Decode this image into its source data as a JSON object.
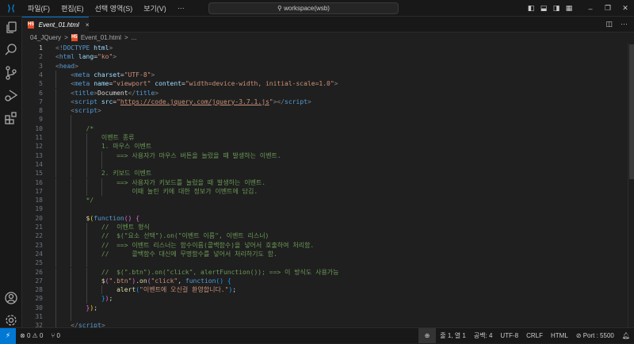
{
  "titlebar": {
    "menus": [
      "파일(F)",
      "편집(E)",
      "선택 영역(S)",
      "보기(V)",
      "···"
    ],
    "search": "workspace(wsb)",
    "back": "←",
    "forward": "→",
    "minimize": "–",
    "restore": "❐",
    "close": "✕"
  },
  "tab": {
    "label": "Event_01.html",
    "icon": "H5",
    "close": "×",
    "more": "···"
  },
  "breadcrumb": {
    "folder": "04_JQuery",
    "sep": ">",
    "file": "Event_01.html",
    "more": "..."
  },
  "editor": {
    "current_line": 1,
    "lines": [
      {
        "i": 0,
        "t": [
          [
            "<!",
            "t"
          ],
          [
            "DOCTYPE ",
            "n"
          ],
          [
            "html",
            "a"
          ],
          [
            ">",
            "t"
          ]
        ]
      },
      {
        "i": 0,
        "t": [
          [
            "<",
            "t"
          ],
          [
            "html ",
            "n"
          ],
          [
            "lang",
            "a"
          ],
          [
            "=",
            "x"
          ],
          [
            "\"ko\"",
            "s"
          ],
          [
            ">",
            "t"
          ]
        ]
      },
      {
        "i": 0,
        "t": [
          [
            "<",
            "t"
          ],
          [
            "head",
            "n"
          ],
          [
            ">",
            "t"
          ]
        ]
      },
      {
        "i": 1,
        "t": [
          [
            "<",
            "t"
          ],
          [
            "meta ",
            "n"
          ],
          [
            "charset",
            "a"
          ],
          [
            "=",
            "x"
          ],
          [
            "\"UTF-8\"",
            "s"
          ],
          [
            ">",
            "t"
          ]
        ]
      },
      {
        "i": 1,
        "t": [
          [
            "<",
            "t"
          ],
          [
            "meta ",
            "n"
          ],
          [
            "name",
            "a"
          ],
          [
            "=",
            "x"
          ],
          [
            "\"viewport\" ",
            "s"
          ],
          [
            "content",
            "a"
          ],
          [
            "=",
            "x"
          ],
          [
            "\"width=device-width, initial-scale=1.0\"",
            "s"
          ],
          [
            ">",
            "t"
          ]
        ]
      },
      {
        "i": 1,
        "t": [
          [
            "<",
            "t"
          ],
          [
            "title",
            "n"
          ],
          [
            ">",
            "t"
          ],
          [
            "Document",
            "x"
          ],
          [
            "</",
            "t"
          ],
          [
            "title",
            "n"
          ],
          [
            ">",
            "t"
          ]
        ]
      },
      {
        "i": 1,
        "t": [
          [
            "<",
            "t"
          ],
          [
            "script ",
            "n"
          ],
          [
            "src",
            "a"
          ],
          [
            "=",
            "x"
          ],
          [
            "\"",
            "s"
          ],
          [
            "https://code.jquery.com/jquery-3.7.1.js",
            "s u"
          ],
          [
            "\"",
            "s"
          ],
          [
            "></",
            "t"
          ],
          [
            "script",
            "n"
          ],
          [
            ">",
            "t"
          ]
        ]
      },
      {
        "i": 1,
        "t": [
          [
            "<",
            "t"
          ],
          [
            "script",
            "n"
          ],
          [
            ">",
            "t"
          ]
        ]
      },
      {
        "i": 2,
        "t": []
      },
      {
        "i": 2,
        "t": [
          [
            "/*",
            "c"
          ]
        ]
      },
      {
        "i": 3,
        "t": [
          [
            "이벤트 종류",
            "c"
          ]
        ]
      },
      {
        "i": 3,
        "t": [
          [
            "1. 마우스 이벤트",
            "c"
          ]
        ]
      },
      {
        "i": 4,
        "t": [
          [
            "==> 사용자가 마우스 버튼을 눌렀을 때 발생하는 이벤트.",
            "c"
          ]
        ]
      },
      {
        "i": 4,
        "t": []
      },
      {
        "i": 3,
        "t": [
          [
            "2. 키보드 이벤트",
            "c"
          ]
        ]
      },
      {
        "i": 4,
        "t": [
          [
            "==> 사용자가 키보드를 눌렀을 때 발생하는 이벤트.",
            "c"
          ]
        ]
      },
      {
        "i": 4,
        "t": [
          [
            "    이때 눌린 키에 대한 정보가 이벤트에 담김.",
            "c"
          ]
        ]
      },
      {
        "i": 2,
        "t": [
          [
            "*/",
            "c"
          ]
        ]
      },
      {
        "i": 2,
        "t": []
      },
      {
        "i": 2,
        "t": [
          [
            "$",
            "f"
          ],
          [
            "(",
            "y"
          ],
          [
            "function",
            "k"
          ],
          [
            "() ",
            "p"
          ],
          [
            "{",
            "p"
          ]
        ]
      },
      {
        "i": 3,
        "t": [
          [
            "//  이벤트 형식",
            "c"
          ]
        ]
      },
      {
        "i": 3,
        "t": [
          [
            "//  $(\"요소 선택\").on(\"이벤트 이름\", 이벤트 리스너)",
            "c"
          ]
        ]
      },
      {
        "i": 3,
        "t": [
          [
            "//  ==> 이벤트 리스너는 함수이름(콜백함수)을 넣어서 호출하여 처리함.",
            "c"
          ]
        ]
      },
      {
        "i": 3,
        "t": [
          [
            "//      콜백함수 대신에 무명함수를 넣어서 처리하기도 함.",
            "c"
          ]
        ]
      },
      {
        "i": 3,
        "t": []
      },
      {
        "i": 3,
        "t": [
          [
            "//  $(\".btn\").on(\"click\", alertFunction()); ==> 이 방식도 사용가능",
            "c"
          ]
        ]
      },
      {
        "i": 3,
        "t": [
          [
            "$",
            "f"
          ],
          [
            "(",
            "p"
          ],
          [
            "\".btn\"",
            "s"
          ],
          [
            ")",
            "p"
          ],
          [
            ".",
            "x"
          ],
          [
            "on",
            "f"
          ],
          [
            "(",
            "p"
          ],
          [
            "\"click\"",
            "s"
          ],
          [
            ", ",
            "x"
          ],
          [
            "function",
            "k"
          ],
          [
            "() ",
            "b"
          ],
          [
            "{",
            "b"
          ]
        ]
      },
      {
        "i": 4,
        "t": [
          [
            "alert",
            "f"
          ],
          [
            "(",
            "b"
          ],
          [
            "\"이벤트에 오신걸 환영합니다.\"",
            "s"
          ],
          [
            ")",
            "b"
          ],
          [
            ";",
            "x"
          ]
        ]
      },
      {
        "i": 3,
        "t": [
          [
            "}",
            "b"
          ],
          [
            ")",
            "p"
          ],
          [
            ";",
            "x"
          ]
        ]
      },
      {
        "i": 2,
        "t": [
          [
            "}",
            "p"
          ],
          [
            ")",
            "y"
          ],
          [
            ";",
            "x"
          ]
        ]
      },
      {
        "i": 2,
        "t": []
      },
      {
        "i": 1,
        "t": [
          [
            "</",
            "t"
          ],
          [
            "script",
            "n"
          ],
          [
            ">",
            "t"
          ]
        ]
      }
    ]
  },
  "status": {
    "remote": "⚡",
    "errors": "0",
    "warnings": "0",
    "ports": "0",
    "position": "줄 1, 열 1",
    "spaces": "공백: 4",
    "encoding": "UTF-8",
    "eol": "CRLF",
    "language": "HTML",
    "port": "Port : 5500"
  }
}
